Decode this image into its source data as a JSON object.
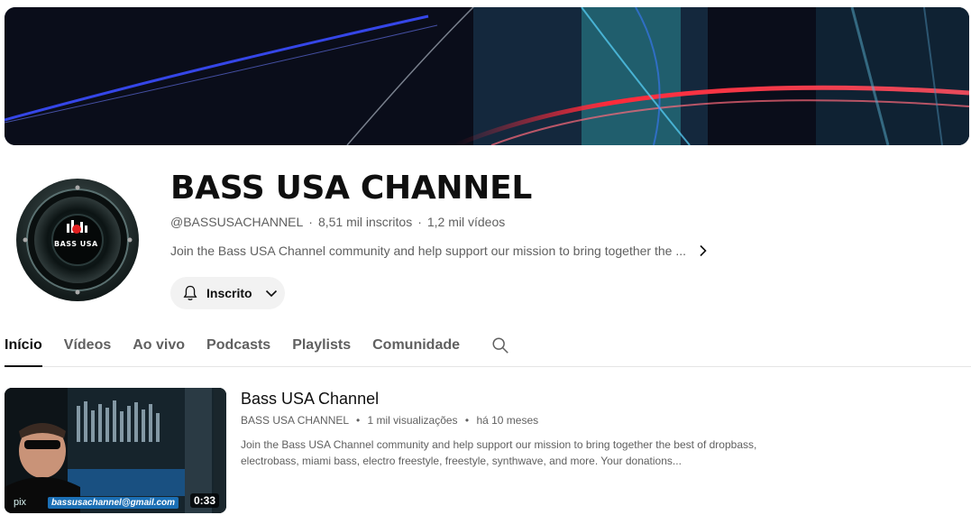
{
  "channel": {
    "name": "BASS USA CHANNEL",
    "handle": "@BASSUSACHANNEL",
    "subscribers": "8,51 mil inscritos",
    "videos": "1,2 mil vídeos",
    "about": "Join the Bass USA Channel community and help support our mission to bring together the ...",
    "avatar_text": "BASS USA",
    "subscribe_label": "Inscrito"
  },
  "tabs": [
    {
      "label": "Início",
      "active": true
    },
    {
      "label": "Vídeos",
      "active": false
    },
    {
      "label": "Ao vivo",
      "active": false
    },
    {
      "label": "Podcasts",
      "active": false
    },
    {
      "label": "Playlists",
      "active": false
    },
    {
      "label": "Comunidade",
      "active": false
    }
  ],
  "featured_video": {
    "title": "Bass USA Channel",
    "channel": "BASS USA CHANNEL",
    "views": "1 mil visualizações",
    "age": "há 10 meses",
    "description": "Join the Bass USA Channel community and help support our mission to bring together the best of dropbass, electrobass, miami bass, electro freestyle, freestyle, synthwave, and more. Your donations...",
    "duration": "0:33",
    "thumb_email": "bassusachannel@gmail.com",
    "thumb_pix": "pix"
  },
  "icons": {
    "bell": "bell-icon",
    "chevron_down": "chevron-down-icon",
    "chevron_right": "chevron-right-icon",
    "search": "search-icon"
  },
  "colors": {
    "text_primary": "#0f0f0f",
    "text_secondary": "#606060",
    "button_bg": "#f2f2f2",
    "avatar_red": "#e02020"
  }
}
